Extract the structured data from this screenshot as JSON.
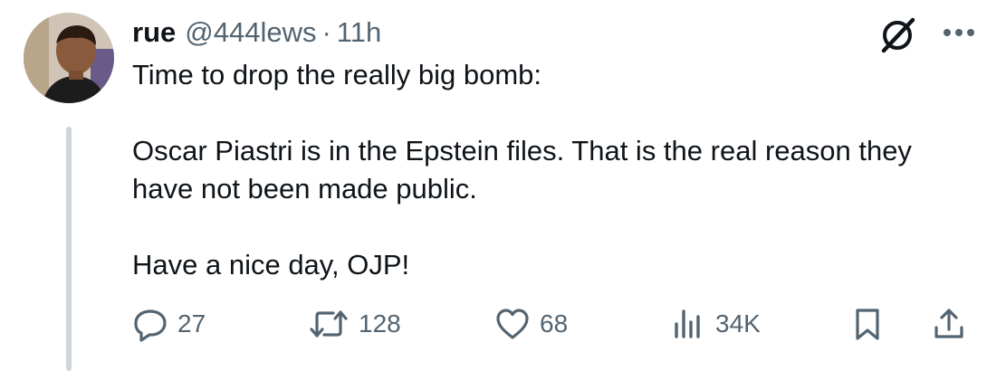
{
  "tweet": {
    "author": {
      "display_name": "rue",
      "handle": "@444lews",
      "separator": "·",
      "time_ago": "11h"
    },
    "body": {
      "paragraph_1": "Time to drop the really big bomb:",
      "paragraph_2": "Oscar Piastri is in the Epstein files. That is the real reason they have not been made public.",
      "paragraph_3": "Have a nice day, OJP!"
    },
    "actions": {
      "replies": "27",
      "reposts": "128",
      "likes": "68",
      "views": "34K"
    }
  },
  "icons": {
    "avatar": "avatar",
    "grok": "grok-icon",
    "more": "more-icon",
    "reply": "reply-icon",
    "repost": "repost-icon",
    "like": "heart-icon",
    "views": "views-icon",
    "bookmark": "bookmark-icon",
    "share": "share-icon"
  },
  "colors": {
    "text_primary": "#0f1419",
    "text_secondary": "#536471",
    "thread_line": "#d0d5da",
    "background": "#ffffff"
  }
}
